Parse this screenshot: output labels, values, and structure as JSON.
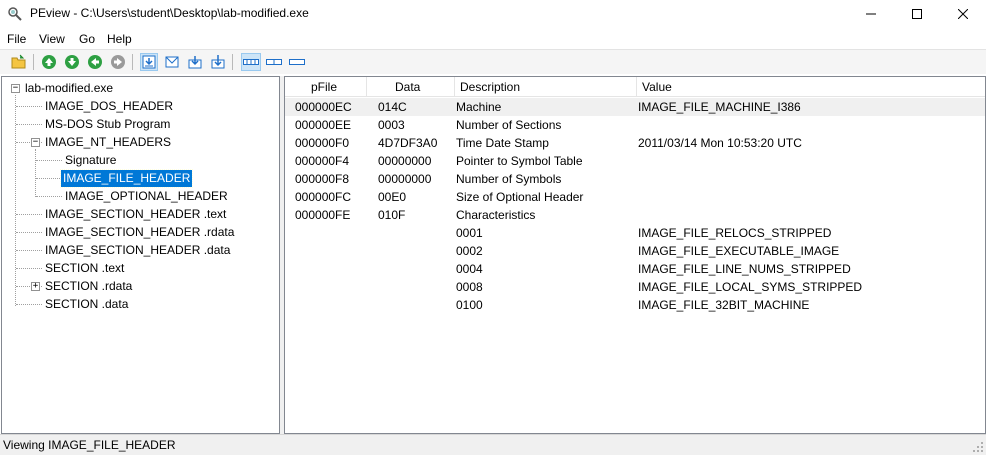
{
  "window": {
    "title": "PEview - C:\\Users\\student\\Desktop\\lab-modified.exe",
    "app_icon": "magnifier-icon"
  },
  "menu": [
    "File",
    "View",
    "Go",
    "Help"
  ],
  "toolbar": {
    "icons": [
      "open-folder-icon",
      "up-arrow-green-icon",
      "down-arrow-green-icon",
      "back-arrow-green-icon",
      "forward-arrow-gray-icon",
      "view-down-icon",
      "view-mail-icon",
      "view-down2-icon",
      "view-down3-icon",
      "view-byte-icon",
      "view-word-icon",
      "view-dword-icon"
    ]
  },
  "tree": {
    "items": [
      {
        "label": "lab-modified.exe",
        "level": 0,
        "expander": "−"
      },
      {
        "label": "IMAGE_DOS_HEADER",
        "level": 1
      },
      {
        "label": "MS-DOS Stub Program",
        "level": 1
      },
      {
        "label": "IMAGE_NT_HEADERS",
        "level": 1,
        "expander": "−"
      },
      {
        "label": "Signature",
        "level": 2
      },
      {
        "label": "IMAGE_FILE_HEADER",
        "level": 2,
        "selected": true
      },
      {
        "label": "IMAGE_OPTIONAL_HEADER",
        "level": 2
      },
      {
        "label": "IMAGE_SECTION_HEADER .text",
        "level": 1
      },
      {
        "label": "IMAGE_SECTION_HEADER .rdata",
        "level": 1
      },
      {
        "label": "IMAGE_SECTION_HEADER .data",
        "level": 1
      },
      {
        "label": "SECTION .text",
        "level": 1
      },
      {
        "label": "SECTION .rdata",
        "level": 1,
        "expander": "+"
      },
      {
        "label": "SECTION .data",
        "level": 1
      }
    ]
  },
  "list": {
    "columns": [
      "pFile",
      "Data",
      "Description",
      "Value"
    ],
    "rows": [
      {
        "pfile": "000000EC",
        "data": "014C",
        "desc": "Machine",
        "value": "IMAGE_FILE_MACHINE_I386"
      },
      {
        "pfile": "000000EE",
        "data": "0003",
        "desc": "Number of Sections",
        "value": ""
      },
      {
        "pfile": "000000F0",
        "data": "4D7DF3A0",
        "desc": "Time Date Stamp",
        "value": "2011/03/14 Mon 10:53:20 UTC"
      },
      {
        "pfile": "000000F4",
        "data": "00000000",
        "desc": "Pointer to Symbol Table",
        "value": ""
      },
      {
        "pfile": "000000F8",
        "data": "00000000",
        "desc": "Number of Symbols",
        "value": ""
      },
      {
        "pfile": "000000FC",
        "data": "00E0",
        "desc": "Size of Optional Header",
        "value": ""
      },
      {
        "pfile": "000000FE",
        "data": "010F",
        "desc": "Characteristics",
        "value": ""
      },
      {
        "pfile": "",
        "data": "",
        "desc": "0001",
        "value": "IMAGE_FILE_RELOCS_STRIPPED"
      },
      {
        "pfile": "",
        "data": "",
        "desc": "0002",
        "value": "IMAGE_FILE_EXECUTABLE_IMAGE"
      },
      {
        "pfile": "",
        "data": "",
        "desc": "0004",
        "value": "IMAGE_FILE_LINE_NUMS_STRIPPED"
      },
      {
        "pfile": "",
        "data": "",
        "desc": "0008",
        "value": "IMAGE_FILE_LOCAL_SYMS_STRIPPED"
      },
      {
        "pfile": "",
        "data": "",
        "desc": "0100",
        "value": "IMAGE_FILE_32BIT_MACHINE"
      }
    ]
  },
  "status": "Viewing IMAGE_FILE_HEADER",
  "colors": {
    "selection": "#0078d7",
    "first_row_bg": "#f0f0f0"
  }
}
